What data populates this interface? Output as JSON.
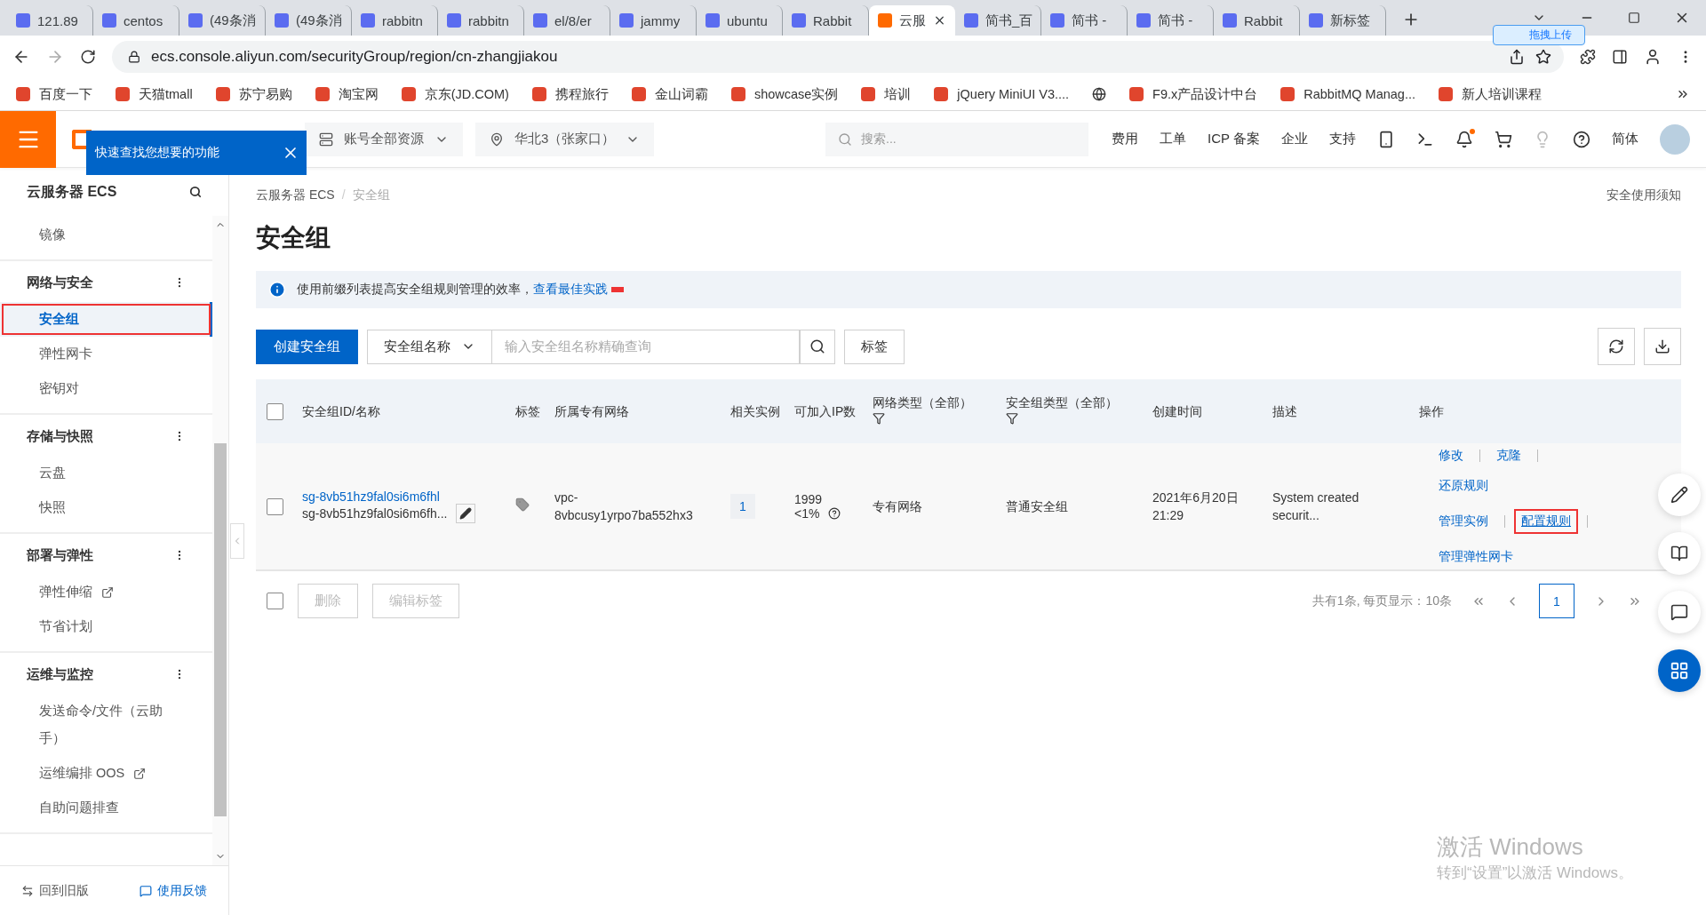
{
  "browser": {
    "tabs": [
      {
        "title": "121.89",
        "selected": false
      },
      {
        "title": "centos",
        "selected": false
      },
      {
        "title": "(49条消",
        "selected": false
      },
      {
        "title": "(49条消",
        "selected": false
      },
      {
        "title": "rabbitn",
        "selected": false
      },
      {
        "title": "rabbitn",
        "selected": false
      },
      {
        "title": "el/8/er",
        "selected": false
      },
      {
        "title": "jammy",
        "selected": false
      },
      {
        "title": "ubuntu",
        "selected": false
      },
      {
        "title": "Rabbit",
        "selected": false
      },
      {
        "title": "云服",
        "selected": true
      },
      {
        "title": "简书_百",
        "selected": false
      },
      {
        "title": "简书 - ",
        "selected": false
      },
      {
        "title": "简书 - ",
        "selected": false
      },
      {
        "title": "Rabbit",
        "selected": false
      },
      {
        "title": "新标签",
        "selected": false
      }
    ],
    "upload_badge": "拖拽上传",
    "address": "ecs.console.aliyun.com/securityGroup/region/cn-zhangjiakou",
    "bookmarks": [
      {
        "kind": "link",
        "label": "百度一下"
      },
      {
        "kind": "link",
        "label": "天猫tmall"
      },
      {
        "kind": "link",
        "label": "苏宁易购"
      },
      {
        "kind": "link",
        "label": "淘宝网"
      },
      {
        "kind": "link",
        "label": "京东(JD.COM)"
      },
      {
        "kind": "link",
        "label": "携程旅行"
      },
      {
        "kind": "link",
        "label": "金山词霸"
      },
      {
        "kind": "link",
        "label": "showcase实例"
      },
      {
        "kind": "link",
        "label": "培训"
      },
      {
        "kind": "link",
        "label": "jQuery MiniUI V3...."
      },
      {
        "kind": "icon"
      },
      {
        "kind": "link",
        "label": "F9.x产品设计中台"
      },
      {
        "kind": "link",
        "label": "RabbitMQ Manag..."
      },
      {
        "kind": "link",
        "label": "新人培训课程"
      }
    ]
  },
  "topbar": {
    "tooltip": "快速查找您想要的功能",
    "resource_scope": "账号全部资源",
    "region": "华北3（张家口）",
    "search_placeholder": "搜索...",
    "links": [
      "费用",
      "工单",
      "ICP 备案",
      "企业",
      "支持"
    ],
    "notification_dot": true,
    "language": "简体"
  },
  "sidebar": {
    "title": "云服务器 ECS",
    "sections": [
      {
        "items": [
          {
            "label": "镜像",
            "selected": false,
            "highlighted": false,
            "external": false
          }
        ]
      },
      {
        "header": "网络与安全",
        "items": [
          {
            "label": "安全组",
            "selected": true,
            "highlighted": true,
            "external": false
          },
          {
            "label": "弹性网卡",
            "selected": false,
            "highlighted": false,
            "external": false
          },
          {
            "label": "密钥对",
            "selected": false,
            "highlighted": false,
            "external": false
          }
        ]
      },
      {
        "header": "存储与快照",
        "items": [
          {
            "label": "云盘",
            "selected": false,
            "highlighted": false,
            "external": false
          },
          {
            "label": "快照",
            "selected": false,
            "highlighted": false,
            "external": false
          }
        ]
      },
      {
        "header": "部署与弹性",
        "items": [
          {
            "label": "弹性伸缩",
            "selected": false,
            "highlighted": false,
            "external": true
          },
          {
            "label": "节省计划",
            "selected": false,
            "highlighted": false,
            "external": false
          }
        ]
      },
      {
        "header": "运维与监控",
        "items": [
          {
            "label": "发送命令/文件（云助手）",
            "selected": false,
            "highlighted": false,
            "external": false
          },
          {
            "label": "运维编排 OOS",
            "selected": false,
            "highlighted": false,
            "external": true
          },
          {
            "label": "自助问题排查",
            "selected": false,
            "highlighted": false,
            "external": false
          }
        ]
      }
    ],
    "footer": [
      "回到旧版",
      "使用反馈"
    ]
  },
  "main": {
    "breadcrumb": [
      "云服务器 ECS",
      "/",
      "安全组"
    ],
    "notice_link": "安全使用须知",
    "title": "安全组",
    "banner": {
      "text": "使用前缀列表提高安全组规则管理的效率，",
      "link": "查看最佳实践"
    },
    "toolbar": {
      "create": "创建安全组",
      "filter_field": "安全组名称",
      "search_placeholder": "输入安全组名称精确查询",
      "tags": "标签"
    },
    "table": {
      "select_all_checked": false,
      "columns": [
        {
          "label": "安全组ID/名称",
          "filter": false
        },
        {
          "label": "标签",
          "filter": false
        },
        {
          "label": "所属专有网络",
          "filter": false
        },
        {
          "label": "相关实例",
          "filter": false
        },
        {
          "label": "可加入IP数",
          "filter": false
        },
        {
          "label": "网络类型（全部）",
          "filter": true
        },
        {
          "label": "安全组类型（全部）",
          "filter": true
        },
        {
          "label": "创建时间",
          "filter": false
        },
        {
          "label": "描述",
          "filter": false
        },
        {
          "label": "操作",
          "filter": false
        }
      ],
      "rows": [
        {
          "checked": false,
          "id": "sg-8vb51hz9fal0si6m6fhl",
          "name": "sg-8vb51hz9fal0si6m6fh...",
          "vpc": "vpc-8vbcusy1yrpo7ba552hx3",
          "instances": "1",
          "ip_count": "1999",
          "ip_usage": "<1%",
          "network_type": "专有网络",
          "group_type": "普通安全组",
          "created": "2021年6月20日 21:29",
          "description": "System created securit...",
          "actions": [
            {
              "label": "修改",
              "highlighted": false
            },
            {
              "label": "克隆",
              "highlighted": false
            },
            {
              "label": "还原规则",
              "highlighted": false
            },
            {
              "label": "管理实例",
              "highlighted": false
            },
            {
              "label": "配置规则",
              "highlighted": true
            },
            {
              "label": "管理弹性网卡",
              "highlighted": false
            }
          ]
        }
      ]
    },
    "footer": {
      "select_all_checked": false,
      "delete": "删除",
      "edit_tags": "编辑标签",
      "total": "共有1条, 每页显示：10条",
      "pages": [
        {
          "label": "1",
          "selected": true
        }
      ]
    }
  },
  "os_watermark": {
    "title": "激活 Windows",
    "subtitle": "转到“设置”以激活 Windows。"
  }
}
